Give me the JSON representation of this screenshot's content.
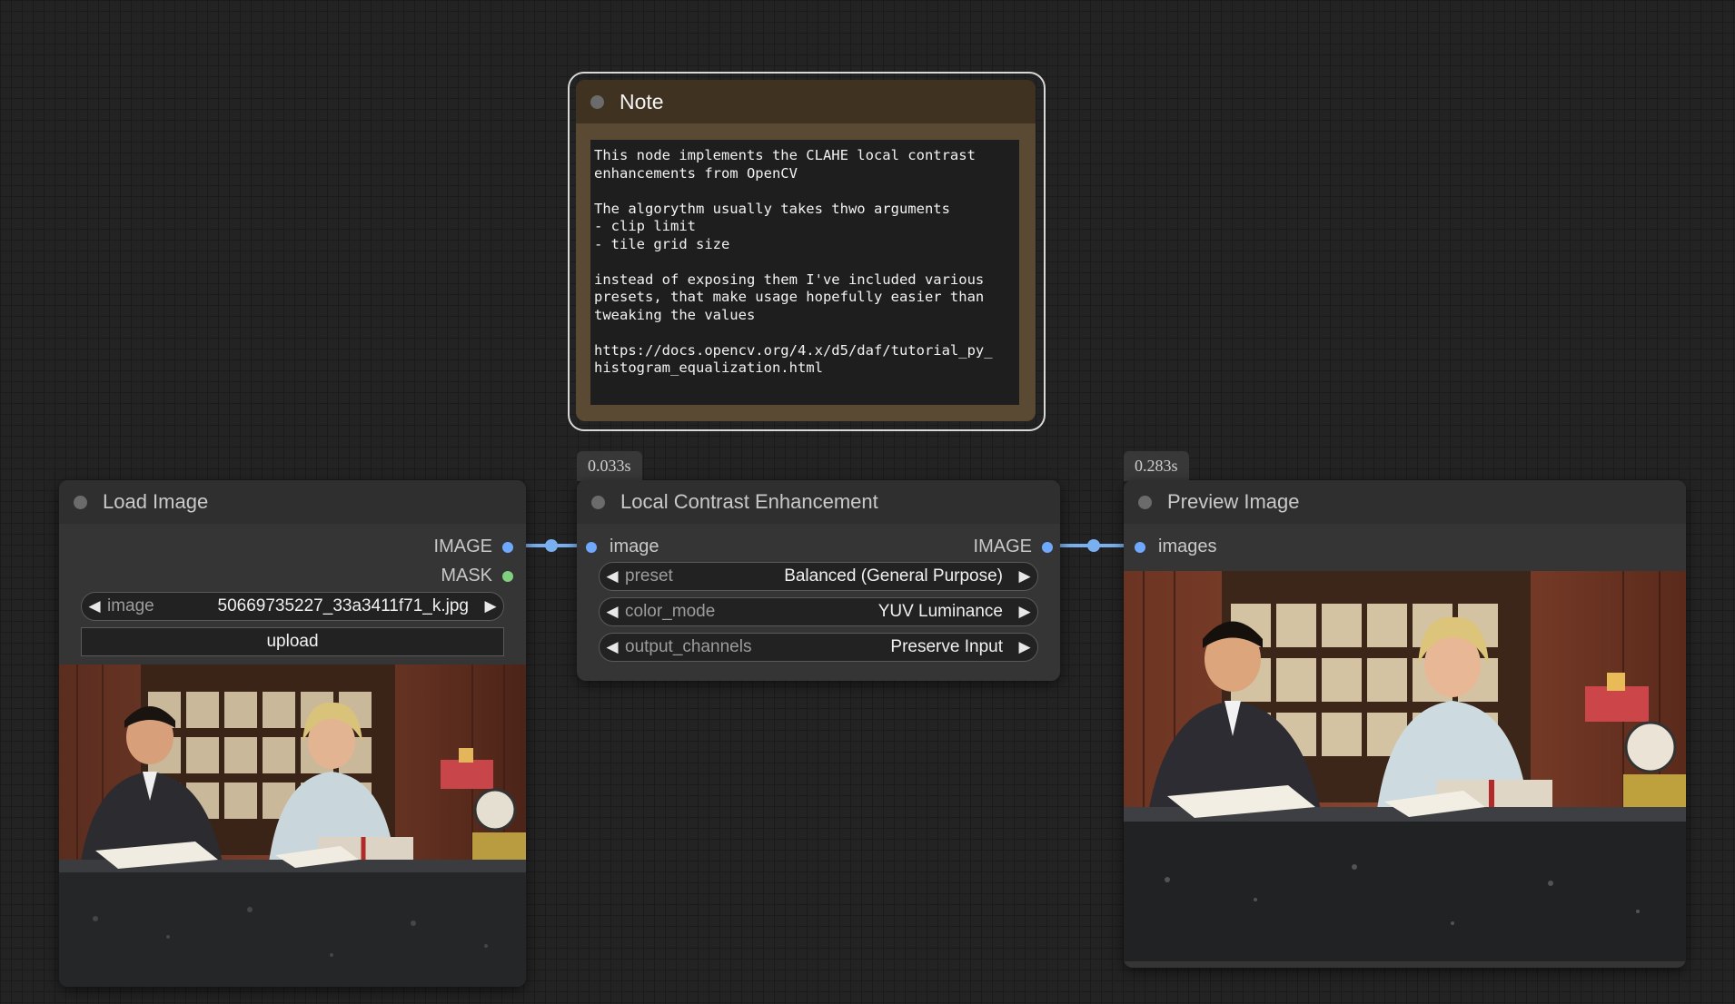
{
  "note": {
    "title": "Note",
    "text": "This node implements the CLAHE local contrast\nenhancements from OpenCV\n\nThe algorythm usually takes thwo arguments\n- clip limit\n- tile grid size\n\ninstead of exposing them I've included various\npresets, that make usage hopefully easier than\ntweaking the values\n\nhttps://docs.opencv.org/4.x/d5/daf/tutorial_py_\nhistogram_equalization.html"
  },
  "load_image": {
    "title": "Load Image",
    "outputs": [
      "IMAGE",
      "MASK"
    ],
    "image_widget": {
      "name": "image",
      "value": "50669735227_33a3411f71_k.jpg"
    },
    "upload_label": "upload"
  },
  "local_contrast": {
    "title": "Local Contrast Enhancement",
    "timing": "0.033s",
    "input": "image",
    "output": "IMAGE",
    "widgets": [
      {
        "name": "preset",
        "value": "Balanced (General Purpose)"
      },
      {
        "name": "color_mode",
        "value": "YUV Luminance"
      },
      {
        "name": "output_channels",
        "value": "Preserve Input"
      }
    ]
  },
  "preview_image": {
    "title": "Preview Image",
    "timing": "0.283s",
    "input": "images"
  },
  "colors": {
    "canvas": "#232323",
    "node": "#353535",
    "wire_image": "#7ab0f0",
    "port_mask": "#7fd07f",
    "note_body": "#5b4a33"
  }
}
